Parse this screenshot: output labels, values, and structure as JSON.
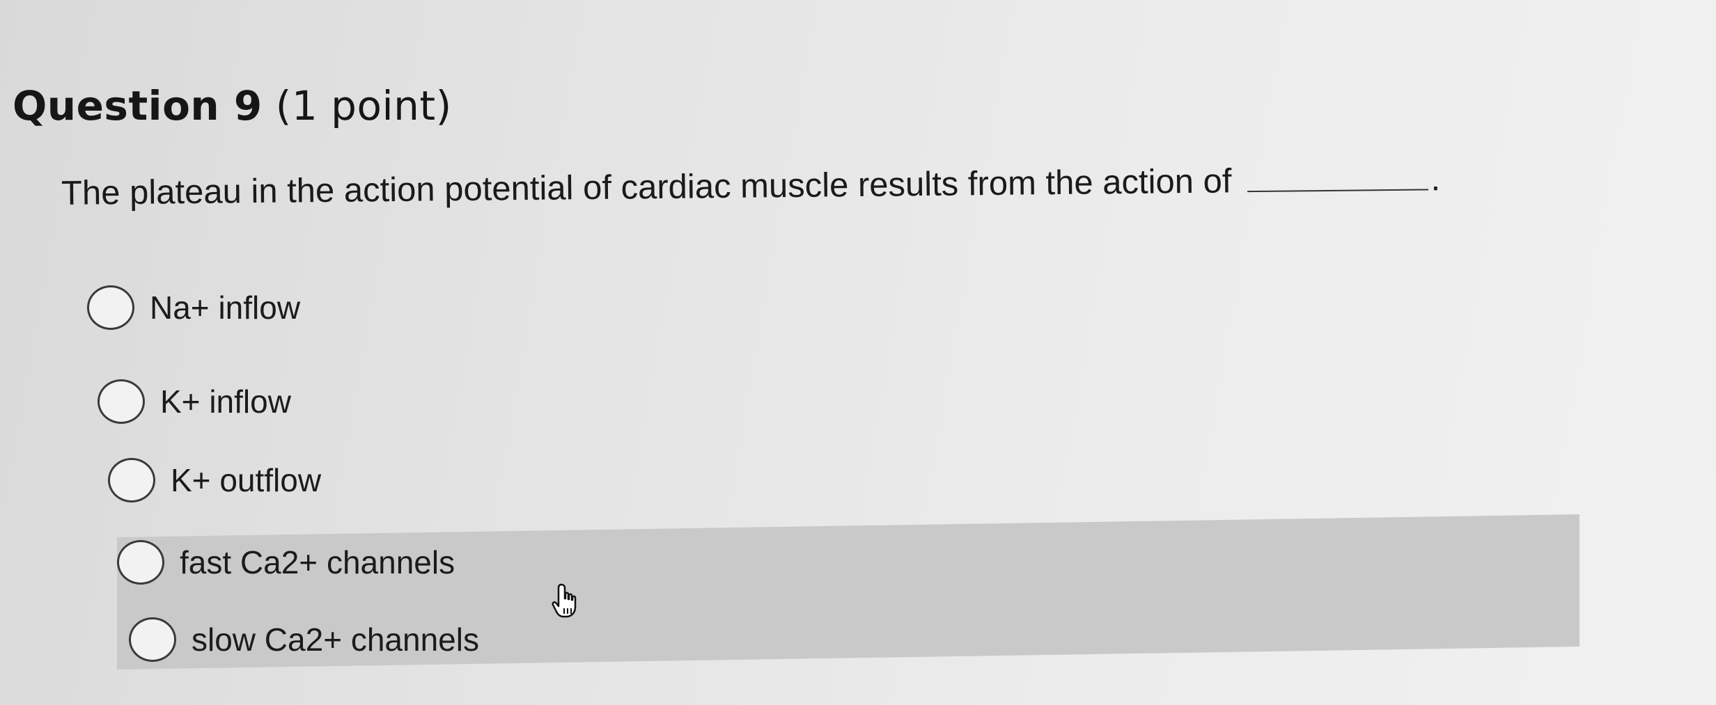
{
  "question": {
    "label": "Question 9",
    "points": "(1 point)",
    "prompt": "The plateau in the action potential of cardiac muscle results from the action of",
    "blank_suffix": "."
  },
  "options": [
    {
      "label": "Na+ inflow",
      "selected": false
    },
    {
      "label": "K+ inflow",
      "selected": false
    },
    {
      "label": "K+ outflow",
      "selected": false
    },
    {
      "label": "fast Ca2+ channels",
      "selected": false
    },
    {
      "label": "slow Ca2+ channels",
      "selected": false
    }
  ],
  "hovered_option": "slow Ca2+ channels",
  "cursor_icon": "hand-pointer-icon",
  "colors": {
    "background": "#e4e4e4",
    "hover_band": "#c9c9c9",
    "text": "#1c1c1c"
  }
}
